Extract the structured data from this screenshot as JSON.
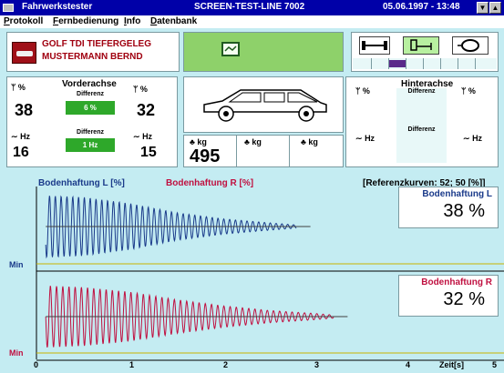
{
  "window": {
    "app_title": "Fahrwerkstester",
    "screen_title": "SCREEN-TEST-LINE 7002",
    "datetime": "05.06.1997 - 13:48"
  },
  "menu": [
    {
      "label": "Protokoll",
      "underline": "P"
    },
    {
      "label": "Fernbedienung",
      "underline": "F"
    },
    {
      "label": "Info",
      "underline": "I"
    },
    {
      "label": "Datenbank",
      "underline": "D"
    }
  ],
  "vehicle": {
    "model": "GOLF TDI TIEFERGELEG",
    "owner": "MUSTERMANN BERND"
  },
  "icons": {
    "logo": "car-logo-icon",
    "green_box": "monitor-icon",
    "tools": [
      "axle-icon",
      "shock-absorber-icon",
      "tire-icon"
    ]
  },
  "front_axle": {
    "title": "Vorderachse",
    "diff_label_top": "Differenz",
    "diff_value_top": "6 %",
    "left_top_unit": "%",
    "right_top_unit": "%",
    "left_percent": "38",
    "right_percent": "32",
    "diff_label_bottom": "Differenz",
    "diff_value_bottom": "1 Hz",
    "left_bottom_unit": "Hz",
    "right_bottom_unit": "Hz",
    "left_hz": "16",
    "right_hz": "15"
  },
  "rear_axle": {
    "title": "Hinterachse",
    "diff_label_top": "Differenz",
    "diff_label_bottom": "Differenz",
    "left_top_unit": "%",
    "right_top_unit": "%",
    "left_bottom_unit": "Hz",
    "right_bottom_unit": "Hz"
  },
  "weights": {
    "unit": "kg",
    "front_total": "495"
  },
  "chart_header": {
    "left_label": "Bodenhaftung L [%]",
    "right_label": "Bodenhaftung R [%]",
    "reference": "[Referenzkurven: 52; 50 [%]]"
  },
  "results": {
    "left_title": "Bodenhaftung L",
    "left_value": "38 %",
    "right_title": "Bodenhaftung R",
    "right_value": "32 %"
  },
  "min_label": "Min",
  "colors": {
    "title_bar": "#0000a8",
    "background": "#c4ecf2",
    "left_trace": "#1a3a8a",
    "right_trace": "#c01040",
    "diff_green": "#2ea82a",
    "reference_line": "#c8b400"
  },
  "chart_data": [
    {
      "type": "line",
      "title": "Bodenhaftung L",
      "xlabel": "Zeit[s]",
      "x_ticks": [
        "0",
        "1",
        "2",
        "3",
        "4",
        "5"
      ],
      "xlim": [
        0,
        5
      ],
      "series": [
        {
          "name": "Bodenhaftung L [%]",
          "envelope": [
            [
              0.1,
              100
            ],
            [
              0.5,
              95
            ],
            [
              1.0,
              75
            ],
            [
              1.5,
              45
            ],
            [
              2.0,
              25
            ],
            [
              2.5,
              12
            ],
            [
              2.8,
              5
            ]
          ]
        }
      ],
      "min_line": "Min"
    },
    {
      "type": "line",
      "title": "Bodenhaftung R",
      "xlabel": "Zeit[s]",
      "x_ticks": [
        "0",
        "1",
        "2",
        "3",
        "4",
        "5"
      ],
      "xlim": [
        0,
        5
      ],
      "series": [
        {
          "name": "Bodenhaftung R [%]",
          "envelope": [
            [
              0.1,
              100
            ],
            [
              0.5,
              95
            ],
            [
              1.0,
              80
            ],
            [
              1.5,
              55
            ],
            [
              2.0,
              35
            ],
            [
              2.5,
              20
            ],
            [
              3.0,
              10
            ],
            [
              3.2,
              5
            ]
          ]
        }
      ],
      "min_line": "Min"
    }
  ],
  "xaxis_label": "Zeit[s]"
}
